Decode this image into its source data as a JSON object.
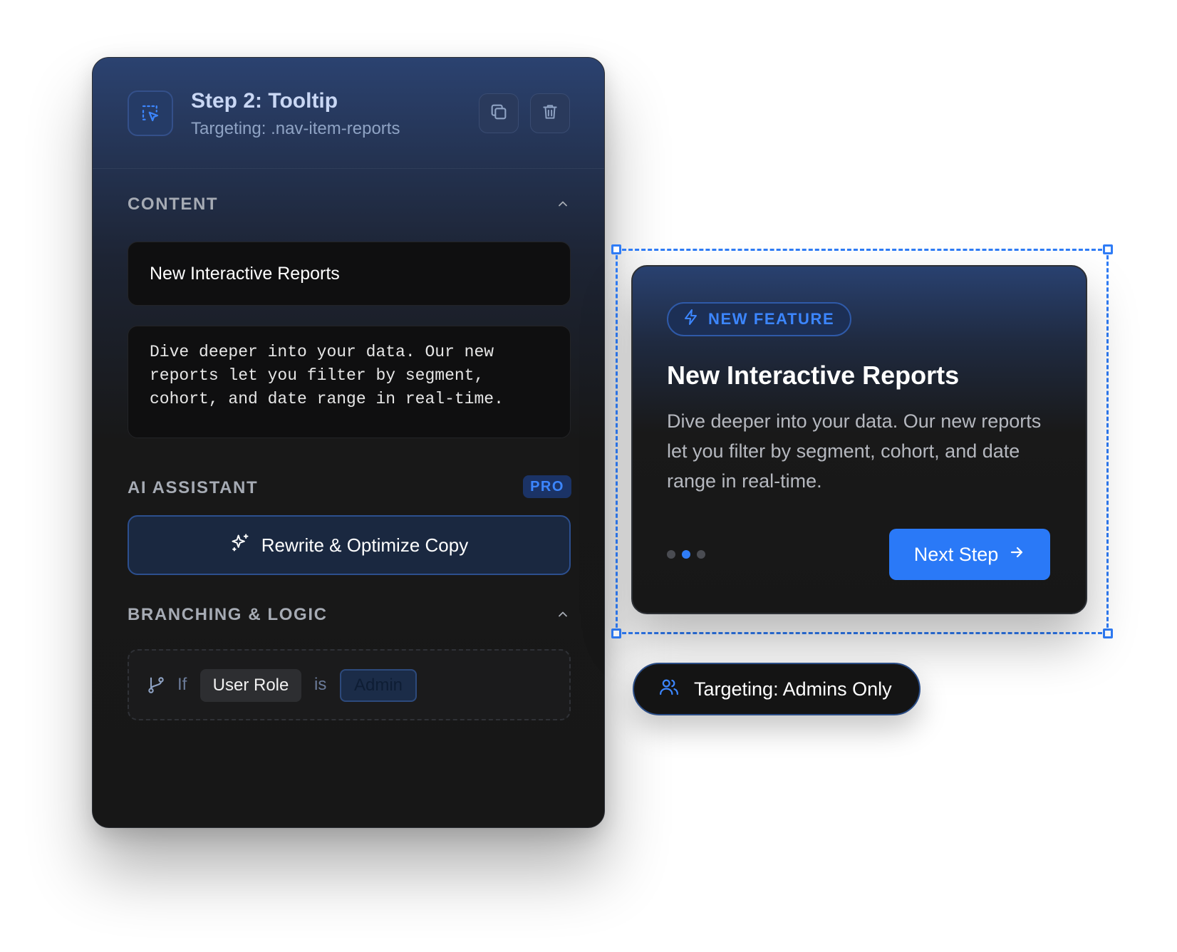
{
  "editor": {
    "step_title": "Step 2: Tooltip",
    "step_target": "Targeting: .nav-item-reports",
    "icons": {
      "step": "selection-cursor-icon",
      "copy": "duplicate-icon",
      "delete": "trash-icon"
    },
    "content_section": {
      "label": "CONTENT",
      "title_value": "New Interactive Reports",
      "body_value": "Dive deeper into your data. Our new reports let you filter by segment, cohort, and date range in real-time."
    },
    "ai_section": {
      "label": "AI ASSISTANT",
      "badge": "PRO",
      "button_label": "Rewrite & Optimize Copy",
      "button_icon": "sparkles-icon"
    },
    "logic_section": {
      "label": "BRANCHING & LOGIC",
      "if_label": "If",
      "field": "User Role",
      "operator": "is",
      "value": "Admin",
      "icon": "git-branch-icon"
    }
  },
  "preview": {
    "badge_label": "NEW FEATURE",
    "badge_icon": "lightning-icon",
    "title": "New Interactive Reports",
    "body": "Dive deeper into your data. Our new reports let you filter by segment, cohort, and date range in real-time.",
    "step_dots": {
      "count": 3,
      "active_index": 1
    },
    "next_button": "Next Step",
    "next_icon": "arrow-right-icon"
  },
  "audience": {
    "label": "Targeting: Admins Only",
    "icon": "users-icon"
  },
  "colors": {
    "accent": "#2a79f7",
    "accent_text": "#3c86ff",
    "panel_top": "#2b4270",
    "panel_bg": "#171717"
  }
}
